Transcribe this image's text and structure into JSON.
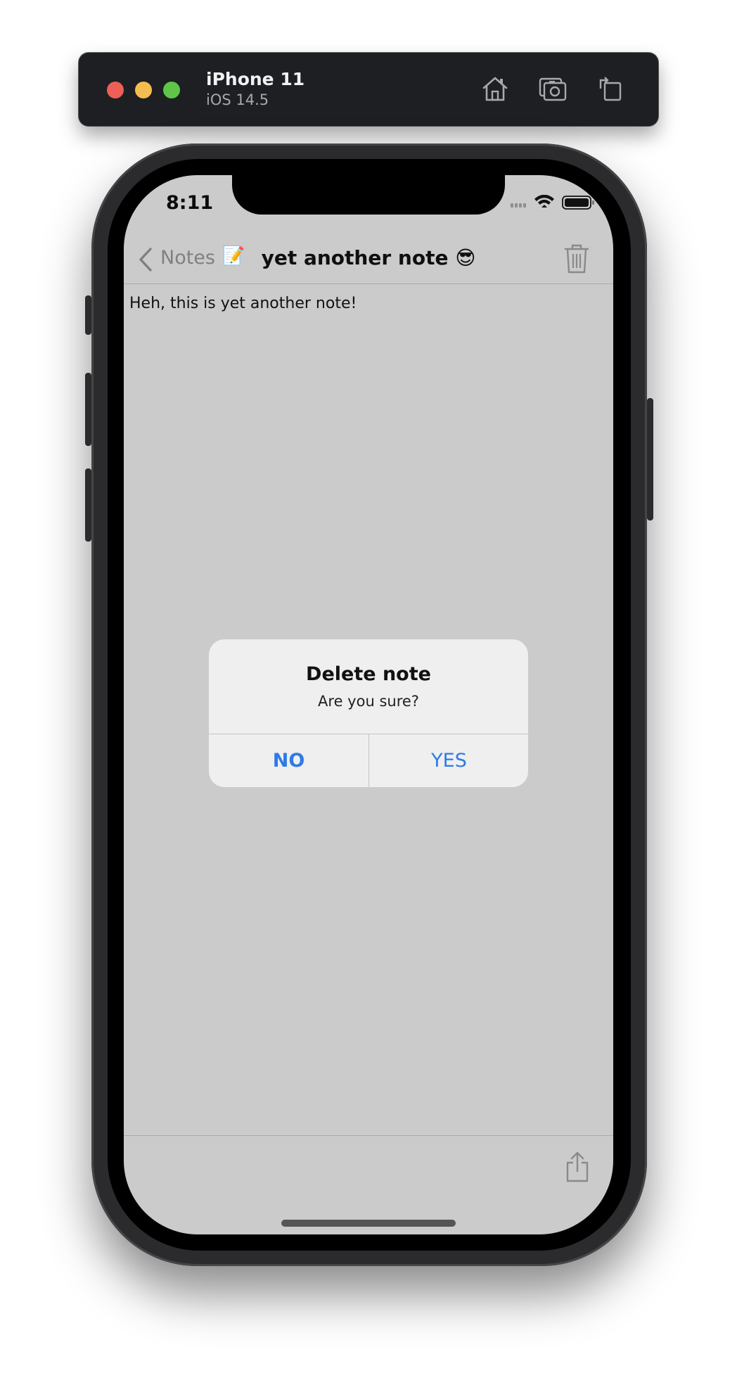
{
  "simulator": {
    "device_name": "iPhone 11",
    "os_version": "iOS 14.5"
  },
  "status_bar": {
    "time": "8:11"
  },
  "nav": {
    "back_label": "Notes",
    "back_emoji": "📝",
    "title": "yet another note 😎"
  },
  "note": {
    "body": "Heh, this is yet another note!"
  },
  "alert": {
    "title": "Delete note",
    "message": "Are you sure?",
    "no_label": "NO",
    "yes_label": "YES"
  },
  "colors": {
    "accent": "#2f7ae5",
    "dimmed_background": "#cbcbcb"
  }
}
